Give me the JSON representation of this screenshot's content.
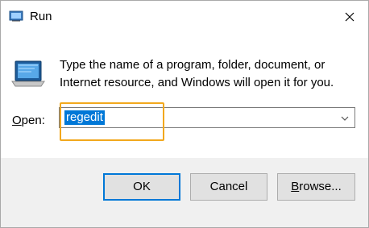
{
  "window": {
    "title": "Run",
    "icon": "run-icon",
    "close_icon": "close-icon"
  },
  "content": {
    "description": "Type the name of a program, folder, document, or Internet resource, and Windows will open it for you.",
    "open_label_prefix": "O",
    "open_label_rest": "pen:",
    "open_value": "regedit"
  },
  "buttons": {
    "ok": "OK",
    "cancel": "Cancel",
    "browse_prefix": "B",
    "browse_rest": "rowse..."
  },
  "colors": {
    "selection": "#0078d7",
    "highlight_box": "#f2a81d"
  }
}
